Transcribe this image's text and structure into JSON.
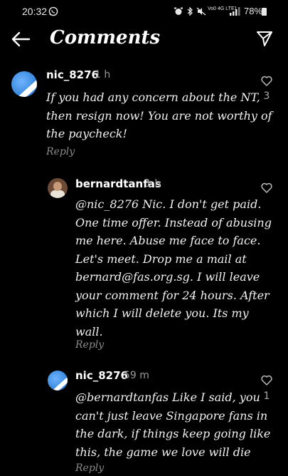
{
  "status": {
    "time": "20:32",
    "network": "Vo0 4G LTE1",
    "battery": "78%"
  },
  "header": {
    "title": "Comments"
  },
  "comments": [
    {
      "user": "nic_8276",
      "time": "1 h",
      "lines": [
        "If you had any concern about the NT,",
        "then resign now! You are not worthy of",
        "the paycheck!"
      ],
      "reply_label": "Reply",
      "likes": "3"
    },
    {
      "user": "bernardtanfas",
      "time": "1 h",
      "lines": [
        "@nic_8276 Nic. I don't get paid.",
        "One time offer. Instead of abusing",
        "me here. Abuse me face to face.",
        "Let's meet. Drop me a mail at",
        "bernard@fas.org.sg. I will leave",
        "your comment for 24 hours. After",
        "which I will delete you. Its my",
        "wall."
      ],
      "reply_label": "Reply",
      "likes": ""
    },
    {
      "user": "nic_8276",
      "time": "59 m",
      "lines": [
        "@bernardtanfas Like I said, you",
        "can't just leave Singapore fans in",
        "the dark, if things keep going like",
        "this, the game we love will die"
      ],
      "reply_label": "Reply",
      "likes": "1"
    }
  ]
}
